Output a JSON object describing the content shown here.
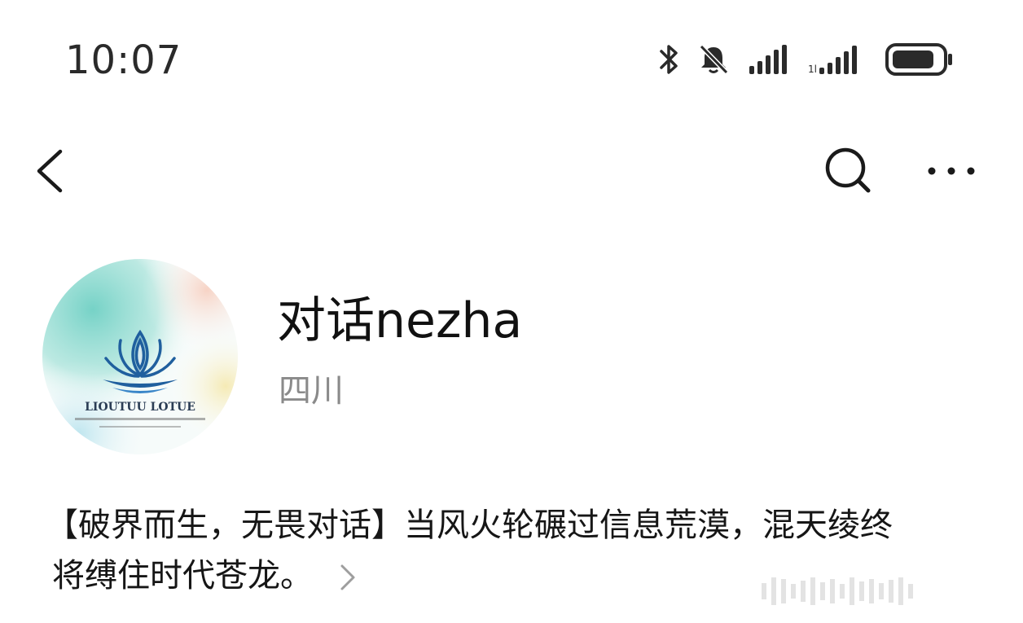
{
  "status_bar": {
    "time": "10:07",
    "icons": [
      "bluetooth-icon",
      "bell-muted-icon",
      "signal-icon",
      "signal-icon-2",
      "battery-icon"
    ],
    "battery_level": 0.8
  },
  "nav": {
    "back_icon": "chevron-left-icon",
    "search_icon": "search-icon",
    "more_icon": "more-horizontal-icon"
  },
  "profile": {
    "avatar_text": "LIOUTUU LOTUE",
    "name": "对话nezha",
    "location": "四川"
  },
  "bio": {
    "line1": "【破界而生，无畏对话】当风火轮碾过信息荒漠，混天绫终",
    "line2": "将缚住时代苍龙。"
  },
  "colors": {
    "text_primary": "#111111",
    "text_secondary": "#8a8a8a",
    "lotus_blue": "#1f5f9e",
    "watercolor_teal": "#7fd3c7"
  }
}
